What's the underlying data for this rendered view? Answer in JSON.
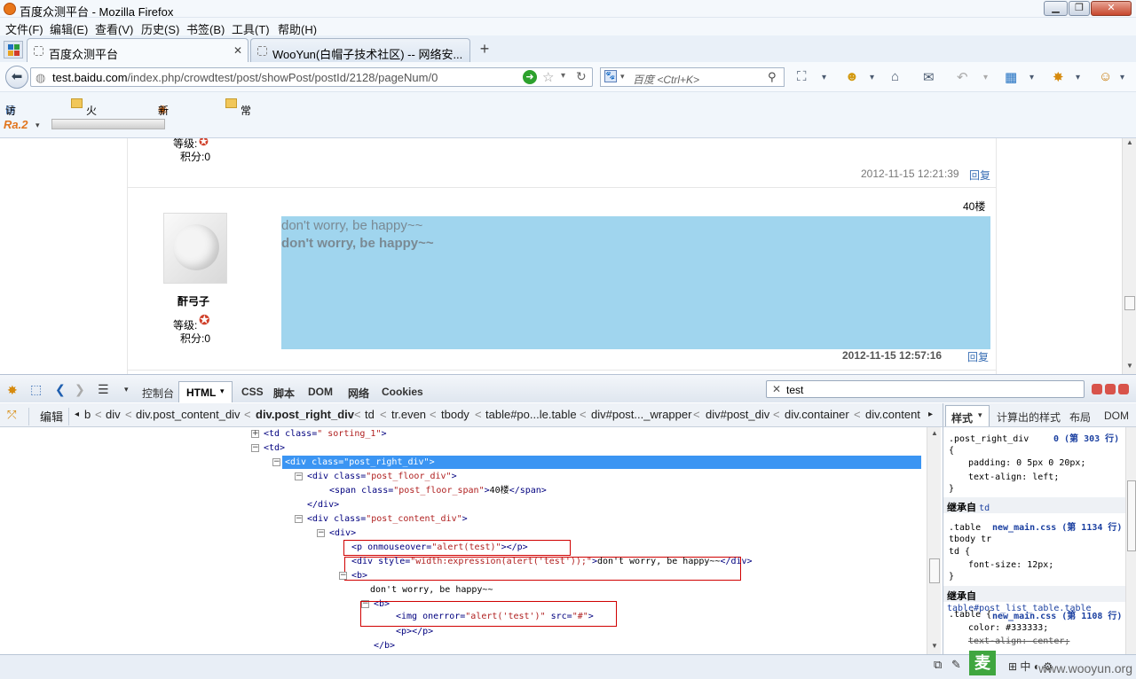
{
  "window": {
    "title": "百度众测平台 - Mozilla Firefox"
  },
  "menu": [
    "文件(F)",
    "编辑(E)",
    "查看(V)",
    "历史(S)",
    "书签(B)",
    "工具(T)",
    "帮助(H)"
  ],
  "tabs": [
    {
      "label": "百度众测平台",
      "active": true
    },
    {
      "label": "WooYun(白帽子技术社区) -- 网络安...",
      "active": false
    }
  ],
  "nav": {
    "url_host": "test.baidu.com",
    "url_path": "/index.php/crowdtest/post/showPost/postId/2128/pageNum/0",
    "search_placeholder": "百度 <Ctrl+K>"
  },
  "bookmarks": [
    "访问最多",
    "火狐官方站点",
    "新手上路",
    "常用网址"
  ],
  "addon_bar": {
    "label": "Ra.2"
  },
  "post": {
    "prev_level_label": "等级:",
    "prev_score": "积分:0",
    "prev_date": "2012-11-15 12:21:39",
    "reply_label": "回复",
    "floor": "40楼",
    "username": "酐弓子",
    "level_label": "等级:",
    "score": "积分:0",
    "line1": "don't worry, be happy~~",
    "line2": "don't worry, be happy~~",
    "date": "2012-11-15 12:57:16"
  },
  "firebug": {
    "tabs": [
      "控制台",
      "HTML",
      "CSS",
      "脚本",
      "DOM",
      "网络",
      "Cookies"
    ],
    "search_value": "test",
    "edit_label": "编辑",
    "breadcrumbs": [
      "b",
      "div",
      "div.post_content_div",
      "div.post_right_div",
      "td",
      "tr.even",
      "tbody",
      "table#po...le.table",
      "div#post..._wrapper",
      "div#post_div",
      "div.container",
      "div.content"
    ],
    "side_tabs": [
      "样式",
      "计算出的样式",
      "布局",
      "DOM"
    ],
    "html_lines": [
      {
        "tag": "<td ",
        "attr": "class=",
        "val": "\" sorting_1\"",
        "end": ">"
      },
      {
        "tag": "<td>"
      },
      {
        "tag": "<div ",
        "attr": "class=",
        "val": "\"post_right_div\"",
        "end": ">"
      },
      {
        "tag": "<div ",
        "attr": "class=",
        "val": "\"post_floor_div\"",
        "end": ">"
      },
      {
        "tag": "<span ",
        "attr": "class=",
        "val": "\"post_floor_span\"",
        "end": ">",
        "text": "40楼",
        "close": "</span>"
      },
      {
        "tag": "</div>"
      },
      {
        "tag": "<div ",
        "attr": "class=",
        "val": "\"post_content_div\"",
        "end": ">"
      },
      {
        "tag": "<div>"
      },
      {
        "tag": "<p ",
        "attr": "onmouseover=",
        "val": "\"alert(test)\"",
        "end": ">",
        "close": "</p>"
      },
      {
        "tag": "<div ",
        "attr": "style=",
        "val": "\"width:expression(alert('test'));\"",
        "end": ">",
        "text": "don't worry, be happy~~",
        "close": "</div>"
      },
      {
        "tag": "<b>"
      },
      {
        "text": "don't worry, be happy~~"
      },
      {
        "tag": "<b>"
      },
      {
        "tag": "<img ",
        "attr": "onerror=",
        "val": "\"alert('test')\"",
        "attr2": " src=",
        "val2": "\"#\"",
        "end": ">"
      },
      {
        "tag": "<p>",
        "close": "</p>"
      },
      {
        "tag": "</b>"
      }
    ],
    "style_rules": {
      "r1_selector": ".post_right_div",
      "r1_source": "0 (第 303 行)",
      "r1_brace_open": "{",
      "r1_p1": "padding: 0 5px 0 20px;",
      "r1_p2": "text-align: left;",
      "r1_brace_close": "}",
      "inherit1": "继承自",
      "inherit1_target": "td",
      "r2_selector": ".table",
      "r2_source": "new_main.css (第 1134 行)",
      "r2_sel2": "tbody tr",
      "r2_sel3": "td {",
      "r2_p1": "font-size: 12px;",
      "r2_brace_close": "}",
      "inherit2": "继承自",
      "inherit2_target": "table#post_list_table.table",
      "r3_selector": ".table {",
      "r3_source": "new_main.css (第 1108 行)",
      "r3_p1": "color: #333333;",
      "r3_p2": "text-align: center;"
    }
  },
  "watermark": "www.wooyun.org",
  "colors": {
    "selection": "#3b95f3",
    "content_bg": "#a0d5ee",
    "red_box": "#d00000"
  }
}
